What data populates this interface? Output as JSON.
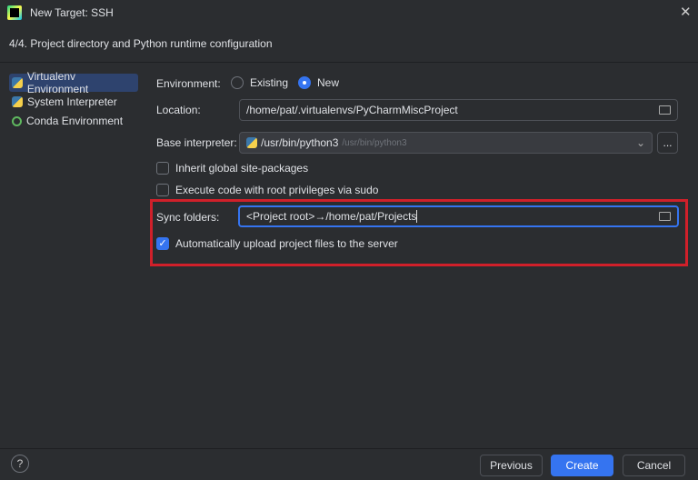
{
  "window": {
    "title": "New Target: SSH",
    "close": "✕"
  },
  "step": "4/4. Project directory and Python runtime configuration",
  "sidebar": {
    "items": [
      {
        "label": "Virtualenv Environment",
        "selected": true
      },
      {
        "label": "System Interpreter"
      },
      {
        "label": "Conda Environment"
      }
    ]
  },
  "form": {
    "environment_label": "Environment:",
    "existing": "Existing",
    "new": "New",
    "location_label": "Location:",
    "location_value": "/home/pat/.virtualenvs/PyCharmMiscProject",
    "base_label": "Base interpreter:",
    "base_value": "/usr/bin/python3",
    "base_hint": "/usr/bin/python3",
    "browse": "...",
    "inherit": "Inherit global site-packages",
    "sudo": "Execute code with root privileges via sudo",
    "sync_label": "Sync folders:",
    "sync_value": "<Project root>→/home/pat/Projects",
    "auto_upload": "Automatically upload project files to the server"
  },
  "footer": {
    "help": "?",
    "previous": "Previous",
    "create": "Create",
    "cancel": "Cancel"
  },
  "colors": {
    "accent": "#3574f0",
    "highlight": "#d0202a"
  }
}
